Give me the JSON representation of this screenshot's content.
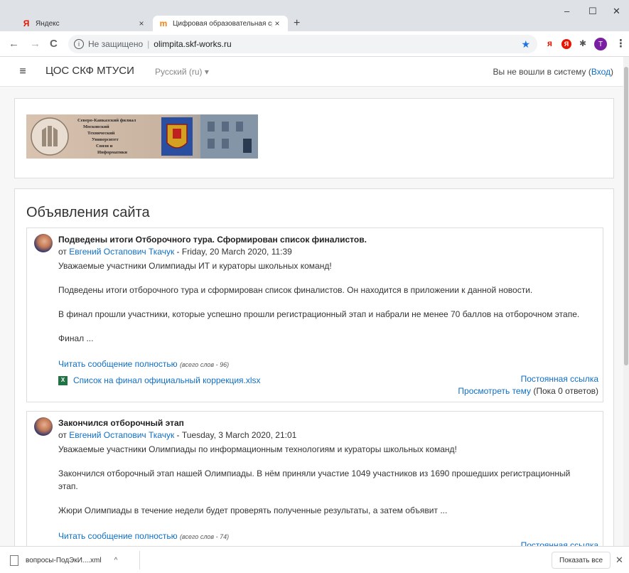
{
  "browser": {
    "tabs": [
      {
        "favicon": "Я",
        "title": "Яндекс",
        "close": "×"
      },
      {
        "favicon": "m",
        "title": "Цифровая образовательная сре",
        "close": "×"
      }
    ],
    "new_tab": "+",
    "window_controls": {
      "minimize": "–",
      "maximize": "☐",
      "close": "✕"
    },
    "nav": {
      "back": "←",
      "forward": "→",
      "reload": "C"
    },
    "address": {
      "info": "i",
      "security_label": "Не защищено",
      "separator": "|",
      "url": "olimpita.skf-works.ru",
      "star": "★"
    },
    "extensions": [
      "я",
      "Я",
      "✱"
    ],
    "profile_letter": "T",
    "menu": "⋮"
  },
  "navbar": {
    "menu_icon": "≡",
    "brand": "ЦОС СКФ МТУСИ",
    "language": "Русский (ru) ▾",
    "login_prefix": "Вы не вошли в систему (",
    "login_link": "Вход",
    "login_suffix": ")"
  },
  "logo": {
    "lines": [
      "Северо-Кавказский филиал",
      "Московский",
      "Технический",
      "Университет",
      "Связи и",
      "Информатики"
    ]
  },
  "news": {
    "title": "Объявления сайта",
    "posts": [
      {
        "subject": "Подведены итоги Отборочного тура. Сформирован список финалистов.",
        "by": "от ",
        "author": "Евгений Остапович Ткачук",
        "date": " - Friday, 20 March 2020, 11:39",
        "paragraphs": [
          "Уважаемые участники Олимпиады ИТ и кураторы школьных команд!",
          "Подведены итоги отборочного тура и сформирован список финалистов. Он находится в приложении к данной новости.",
          "В финал прошли участники, которые успешно прошли регистрационный этап и набрали не менее 70 баллов на отборочном этапе.",
          "Финал ..."
        ],
        "read_more": "Читать сообщение полностью",
        "word_count": "(всего слов - 96)",
        "attachment": "Список на финал официальный коррекция.xlsx",
        "permalink": "Постоянная ссылка",
        "view_topic": "Просмотреть тему",
        "replies": " (Пока 0 ответов)"
      },
      {
        "subject": "Закончился отборочный этап",
        "by": "от ",
        "author": "Евгений Остапович Ткачук",
        "date": " - Tuesday, 3 March 2020, 21:01",
        "paragraphs": [
          "Уважаемые участники Олимпиады по информационным технологиям и кураторы школьных команд!",
          "Закончился отборочный этап нашей Олимпиады. В нём приняли участие 1049 участников из 1690 прошедших регистрационный этап.",
          "Жюри Олимпиады в течение недели будет проверять полученные результаты, а затем объявит ..."
        ],
        "read_more": "Читать сообщение полностью",
        "word_count": "(всего слов - 74)",
        "permalink": "Постоянная ссылка"
      }
    ]
  },
  "downloads": {
    "file": "вопросы-ПодЭкИ....xml",
    "caret": "^",
    "show_all": "Показать все",
    "close": "✕"
  },
  "colors": {
    "link": "#0f6fc5",
    "tabstrip": "#dee1e6",
    "profile": "#7b1fa2"
  }
}
